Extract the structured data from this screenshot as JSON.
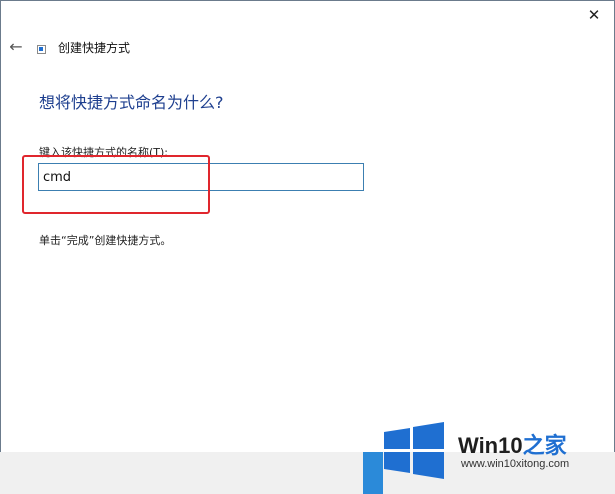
{
  "window": {
    "title": "创建快捷方式",
    "close_glyph": "✕",
    "back_glyph": "←"
  },
  "page": {
    "heading": "想将快捷方式命名为什么?",
    "field_label": "键入该快捷方式的名称(T):",
    "name_value": "cmd",
    "hint": "单击“完成”创建快捷方式。"
  },
  "watermark": {
    "brand_main": "Win10",
    "brand_accent": "之家",
    "url": "www.win10xitong.com"
  },
  "colors": {
    "heading": "#1e3f8f",
    "highlight": "#e0262d",
    "input_border": "#3c7fb1",
    "logo_blue": "#1f6fd1"
  },
  "icons": {
    "back": "arrow-left-icon",
    "close": "close-icon",
    "shortcut": "shortcut-icon",
    "logo": "windows-logo-icon"
  }
}
